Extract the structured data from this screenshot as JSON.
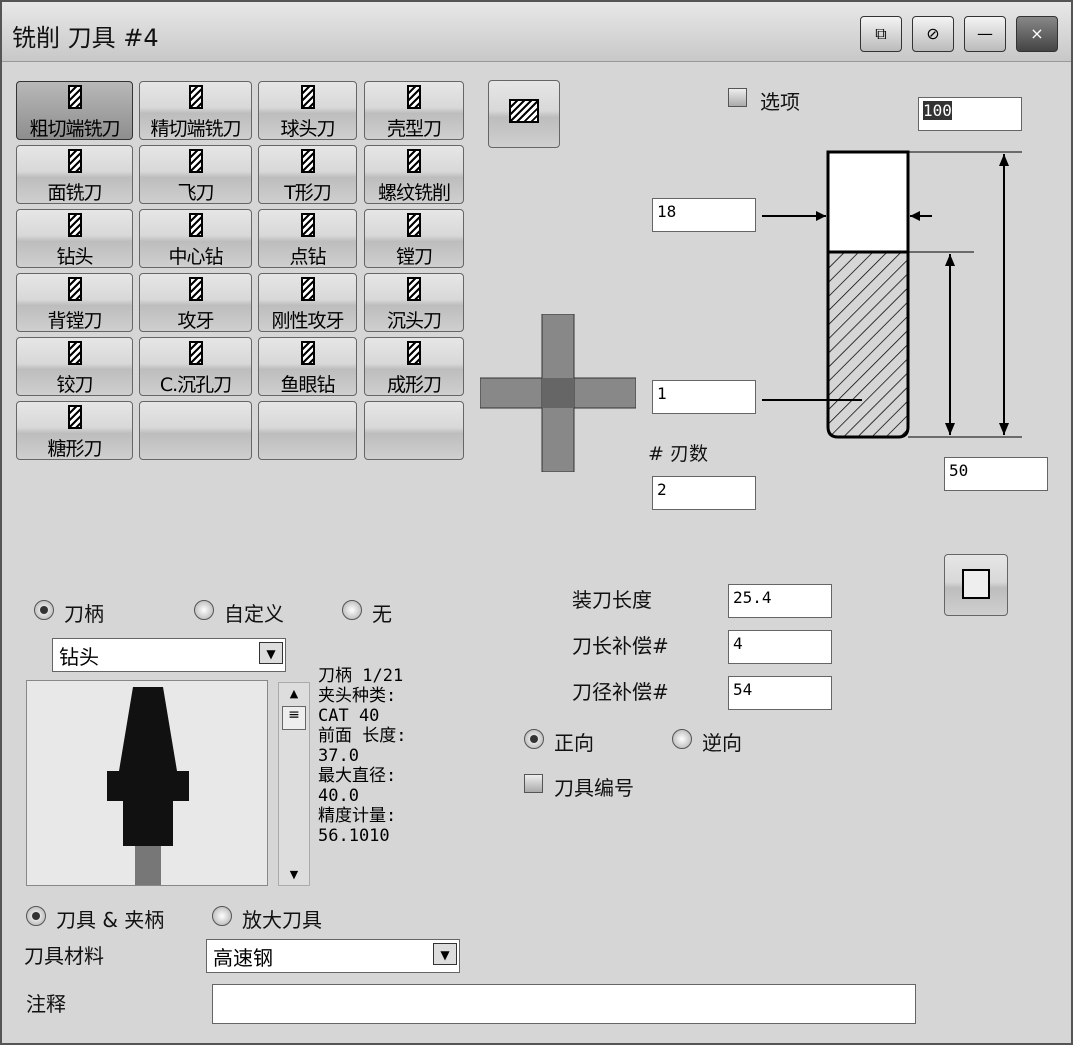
{
  "window": {
    "title": "铣削 刀具 #4",
    "buttons": [
      "⧉",
      "⊘",
      "—",
      "×"
    ]
  },
  "tools": [
    {
      "label": "粗切端铣刀",
      "selected": true
    },
    {
      "label": "精切端铣刀"
    },
    {
      "label": "球头刀"
    },
    {
      "label": "壳型刀"
    },
    {
      "label": "面铣刀"
    },
    {
      "label": "飞刀"
    },
    {
      "label": "T形刀"
    },
    {
      "label": "螺纹铣削"
    },
    {
      "label": "钻头"
    },
    {
      "label": "中心钻"
    },
    {
      "label": "点钻"
    },
    {
      "label": "镗刀"
    },
    {
      "label": "背镗刀"
    },
    {
      "label": "攻牙"
    },
    {
      "label": "刚性攻牙"
    },
    {
      "label": "沉头刀"
    },
    {
      "label": "铰刀"
    },
    {
      "label": "C.沉孔刀"
    },
    {
      "label": "鱼眼钻"
    },
    {
      "label": "成形刀"
    },
    {
      "label": "糖形刀"
    },
    {
      "label": ""
    },
    {
      "label": ""
    },
    {
      "label": ""
    }
  ],
  "options_label": "选项",
  "dims": {
    "overall_length": "100",
    "diameter": "18",
    "corner_radius": "1",
    "flute_length": "50",
    "flutes_label": "# 刃数",
    "flutes": "2"
  },
  "holder": {
    "radio_holder": "刀柄",
    "radio_custom": "自定义",
    "radio_none": "无",
    "holder_type": "钻头",
    "info": [
      "刀柄 1/21",
      "夹头种类:",
      "CAT 40",
      "前面 长度:",
      "37.0",
      "最大直径:",
      "40.0",
      "精度计量:",
      "56.1010"
    ]
  },
  "offsets": {
    "stickout_label": "装刀长度",
    "stickout": "25.4",
    "length_offset_label": "刀长补偿#",
    "length_offset": "4",
    "dia_offset_label": "刀径补偿#",
    "dia_offset": "54"
  },
  "direction": {
    "cw": "正向",
    "ccw": "逆向"
  },
  "tool_number_label": "刀具编号",
  "view": {
    "tool_holder": "刀具 & 夹柄",
    "zoom_tool": "放大刀具"
  },
  "material": {
    "label": "刀具材料",
    "value": "高速钢"
  },
  "comment": {
    "label": "注释",
    "value": ""
  }
}
